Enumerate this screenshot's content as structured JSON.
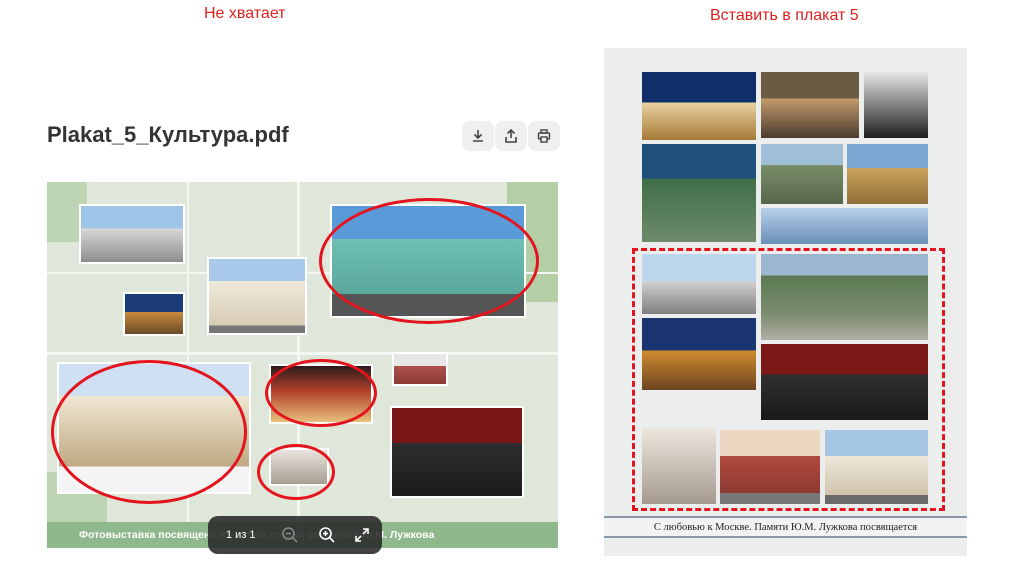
{
  "annotations": {
    "left_label": "Не хватает",
    "right_label": "Вставить в плакат 5",
    "accent_color": "#e3141d"
  },
  "viewer": {
    "title": "Plakat_5_Культура.pdf",
    "toolbar": {
      "download_icon": "download-icon",
      "share_icon": "share-icon",
      "print_icon": "print-icon"
    },
    "banner_text": "Фотовыставка посвящена 85-летию со дня рождения Ю.М. Лужкова",
    "page_counter": "1 из 1",
    "controls": {
      "zoom_out_icon": "zoom-out-icon",
      "zoom_in_icon": "zoom-in-icon",
      "fullscreen_icon": "fullscreen-icon"
    }
  },
  "poster": {
    "footer_text": "С любовью к Москве. Памяти Ю.М. Лужкова посвящается"
  }
}
